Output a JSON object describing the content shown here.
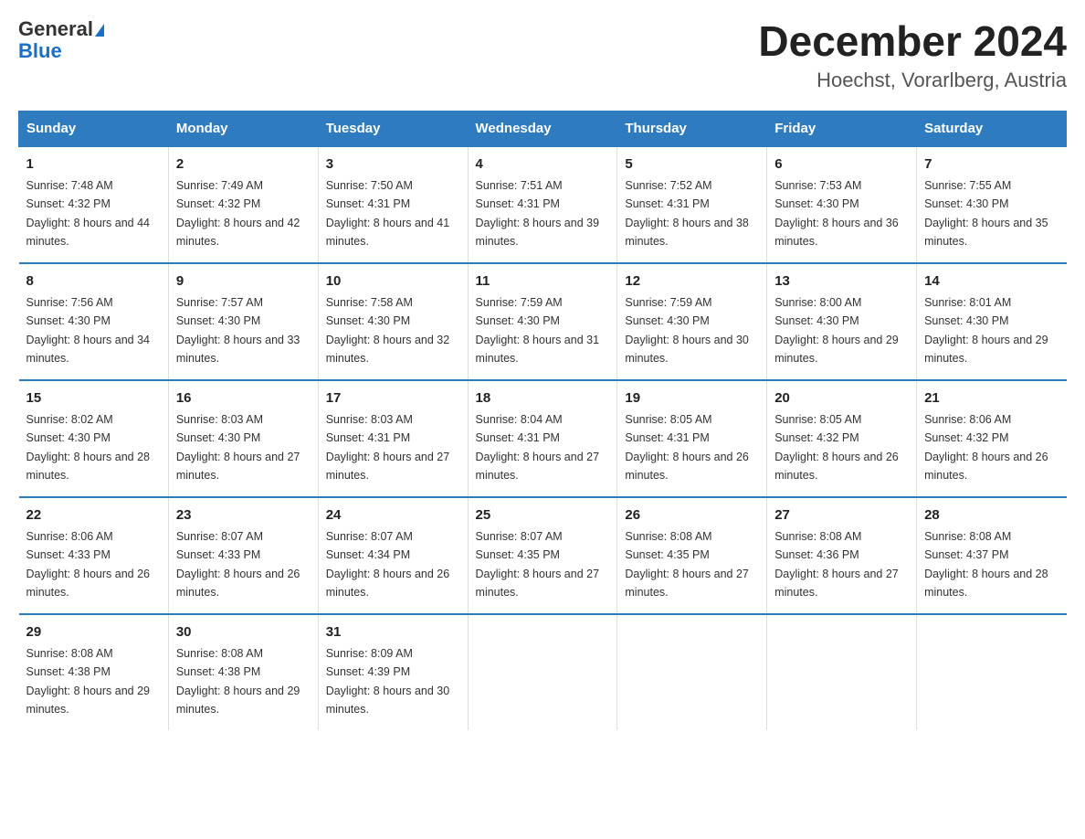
{
  "logo": {
    "line1": "General",
    "line2": "Blue"
  },
  "title": "December 2024",
  "subtitle": "Hoechst, Vorarlberg, Austria",
  "days_of_week": [
    "Sunday",
    "Monday",
    "Tuesday",
    "Wednesday",
    "Thursday",
    "Friday",
    "Saturday"
  ],
  "weeks": [
    [
      {
        "day": "1",
        "sunrise": "7:48 AM",
        "sunset": "4:32 PM",
        "daylight": "8 hours and 44 minutes."
      },
      {
        "day": "2",
        "sunrise": "7:49 AM",
        "sunset": "4:32 PM",
        "daylight": "8 hours and 42 minutes."
      },
      {
        "day": "3",
        "sunrise": "7:50 AM",
        "sunset": "4:31 PM",
        "daylight": "8 hours and 41 minutes."
      },
      {
        "day": "4",
        "sunrise": "7:51 AM",
        "sunset": "4:31 PM",
        "daylight": "8 hours and 39 minutes."
      },
      {
        "day": "5",
        "sunrise": "7:52 AM",
        "sunset": "4:31 PM",
        "daylight": "8 hours and 38 minutes."
      },
      {
        "day": "6",
        "sunrise": "7:53 AM",
        "sunset": "4:30 PM",
        "daylight": "8 hours and 36 minutes."
      },
      {
        "day": "7",
        "sunrise": "7:55 AM",
        "sunset": "4:30 PM",
        "daylight": "8 hours and 35 minutes."
      }
    ],
    [
      {
        "day": "8",
        "sunrise": "7:56 AM",
        "sunset": "4:30 PM",
        "daylight": "8 hours and 34 minutes."
      },
      {
        "day": "9",
        "sunrise": "7:57 AM",
        "sunset": "4:30 PM",
        "daylight": "8 hours and 33 minutes."
      },
      {
        "day": "10",
        "sunrise": "7:58 AM",
        "sunset": "4:30 PM",
        "daylight": "8 hours and 32 minutes."
      },
      {
        "day": "11",
        "sunrise": "7:59 AM",
        "sunset": "4:30 PM",
        "daylight": "8 hours and 31 minutes."
      },
      {
        "day": "12",
        "sunrise": "7:59 AM",
        "sunset": "4:30 PM",
        "daylight": "8 hours and 30 minutes."
      },
      {
        "day": "13",
        "sunrise": "8:00 AM",
        "sunset": "4:30 PM",
        "daylight": "8 hours and 29 minutes."
      },
      {
        "day": "14",
        "sunrise": "8:01 AM",
        "sunset": "4:30 PM",
        "daylight": "8 hours and 29 minutes."
      }
    ],
    [
      {
        "day": "15",
        "sunrise": "8:02 AM",
        "sunset": "4:30 PM",
        "daylight": "8 hours and 28 minutes."
      },
      {
        "day": "16",
        "sunrise": "8:03 AM",
        "sunset": "4:30 PM",
        "daylight": "8 hours and 27 minutes."
      },
      {
        "day": "17",
        "sunrise": "8:03 AM",
        "sunset": "4:31 PM",
        "daylight": "8 hours and 27 minutes."
      },
      {
        "day": "18",
        "sunrise": "8:04 AM",
        "sunset": "4:31 PM",
        "daylight": "8 hours and 27 minutes."
      },
      {
        "day": "19",
        "sunrise": "8:05 AM",
        "sunset": "4:31 PM",
        "daylight": "8 hours and 26 minutes."
      },
      {
        "day": "20",
        "sunrise": "8:05 AM",
        "sunset": "4:32 PM",
        "daylight": "8 hours and 26 minutes."
      },
      {
        "day": "21",
        "sunrise": "8:06 AM",
        "sunset": "4:32 PM",
        "daylight": "8 hours and 26 minutes."
      }
    ],
    [
      {
        "day": "22",
        "sunrise": "8:06 AM",
        "sunset": "4:33 PM",
        "daylight": "8 hours and 26 minutes."
      },
      {
        "day": "23",
        "sunrise": "8:07 AM",
        "sunset": "4:33 PM",
        "daylight": "8 hours and 26 minutes."
      },
      {
        "day": "24",
        "sunrise": "8:07 AM",
        "sunset": "4:34 PM",
        "daylight": "8 hours and 26 minutes."
      },
      {
        "day": "25",
        "sunrise": "8:07 AM",
        "sunset": "4:35 PM",
        "daylight": "8 hours and 27 minutes."
      },
      {
        "day": "26",
        "sunrise": "8:08 AM",
        "sunset": "4:35 PM",
        "daylight": "8 hours and 27 minutes."
      },
      {
        "day": "27",
        "sunrise": "8:08 AM",
        "sunset": "4:36 PM",
        "daylight": "8 hours and 27 minutes."
      },
      {
        "day": "28",
        "sunrise": "8:08 AM",
        "sunset": "4:37 PM",
        "daylight": "8 hours and 28 minutes."
      }
    ],
    [
      {
        "day": "29",
        "sunrise": "8:08 AM",
        "sunset": "4:38 PM",
        "daylight": "8 hours and 29 minutes."
      },
      {
        "day": "30",
        "sunrise": "8:08 AM",
        "sunset": "4:38 PM",
        "daylight": "8 hours and 29 minutes."
      },
      {
        "day": "31",
        "sunrise": "8:09 AM",
        "sunset": "4:39 PM",
        "daylight": "8 hours and 30 minutes."
      },
      null,
      null,
      null,
      null
    ]
  ]
}
